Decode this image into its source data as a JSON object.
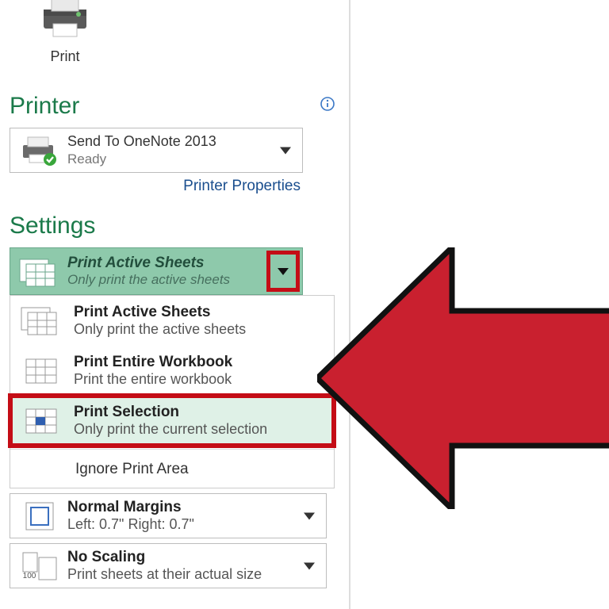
{
  "print_button": {
    "label": "Print"
  },
  "printer_section": {
    "heading": "Printer",
    "selected_name": "Send To OneNote 2013",
    "selected_status": "Ready",
    "properties_link": "Printer Properties"
  },
  "settings_section": {
    "heading": "Settings",
    "selected_dropdown": {
      "title": "Print Active Sheets",
      "sub": "Only print the active sheets"
    },
    "menu": [
      {
        "title": "Print Active Sheets",
        "sub": "Only print the active sheets"
      },
      {
        "title": "Print Entire Workbook",
        "sub": "Print the entire workbook"
      },
      {
        "title": "Print Selection",
        "sub": "Only print the current selection",
        "highlighted": true
      }
    ],
    "ignore_print_area": "Ignore Print Area",
    "margins": {
      "title": "Normal Margins",
      "sub": "Left: 0.7\"   Right: 0.7\""
    },
    "scaling": {
      "title": "No Scaling",
      "sub": "Print sheets at their actual size"
    }
  },
  "annotation": {
    "arrow_color": "#c9202f",
    "arrow_stroke": "#111111"
  }
}
